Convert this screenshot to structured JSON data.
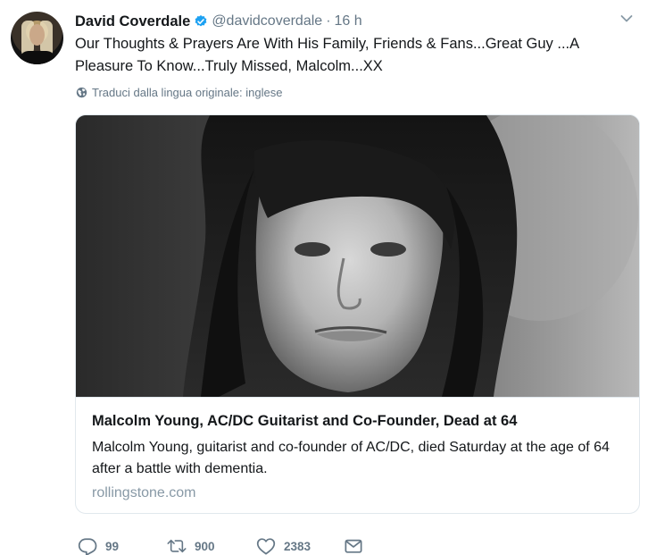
{
  "author": {
    "name": "David Coverdale",
    "handle": "@davidcoverdale",
    "separator": "·",
    "time": "16 h",
    "verified": true
  },
  "tweet": {
    "text": "Our Thoughts & Prayers Are With His Family, Friends & Fans...Great Guy ...A Pleasure To Know...Truly Missed, Malcolm...XX",
    "translate_label": "Traduci dalla lingua originale: inglese"
  },
  "card": {
    "title": "Malcolm Young, AC/DC Guitarist and Co-Founder, Dead at 64",
    "description": "Malcolm Young, guitarist and co-founder of AC/DC, died Saturday at the age of 64 after a battle with dementia.",
    "domain": "rollingstone.com"
  },
  "actions": {
    "replies": "99",
    "retweets": "900",
    "likes": "2383"
  },
  "icons": {
    "verified": "verified-badge-icon",
    "caret": "chevron-down-icon",
    "globe": "globe-icon",
    "reply": "reply-icon",
    "retweet": "retweet-icon",
    "like": "heart-icon",
    "dm": "envelope-icon"
  },
  "colors": {
    "text_primary": "#14171a",
    "text_secondary": "#657786",
    "verified_blue": "#1da1f2",
    "border": "#e1e8ed",
    "domain_gray": "#8899a6"
  }
}
